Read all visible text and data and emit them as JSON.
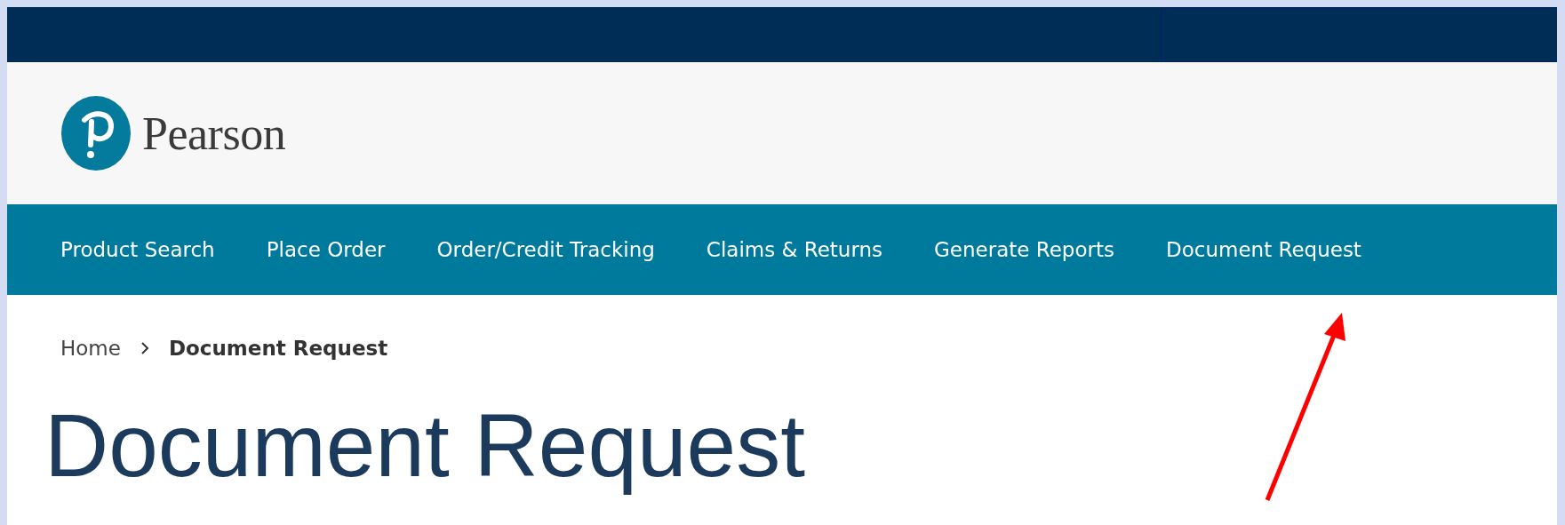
{
  "logo": {
    "text": "Pearson"
  },
  "nav": [
    {
      "label": "Product Search"
    },
    {
      "label": "Place Order"
    },
    {
      "label": "Order/Credit Tracking"
    },
    {
      "label": "Claims & Returns"
    },
    {
      "label": "Generate Reports"
    },
    {
      "label": "Document Request"
    }
  ],
  "breadcrumb": [
    {
      "label": "Home",
      "current": false
    },
    {
      "label": "Document Request",
      "current": true
    }
  ],
  "page_title": "Document Request",
  "annotation": {
    "kind": "arrow"
  }
}
